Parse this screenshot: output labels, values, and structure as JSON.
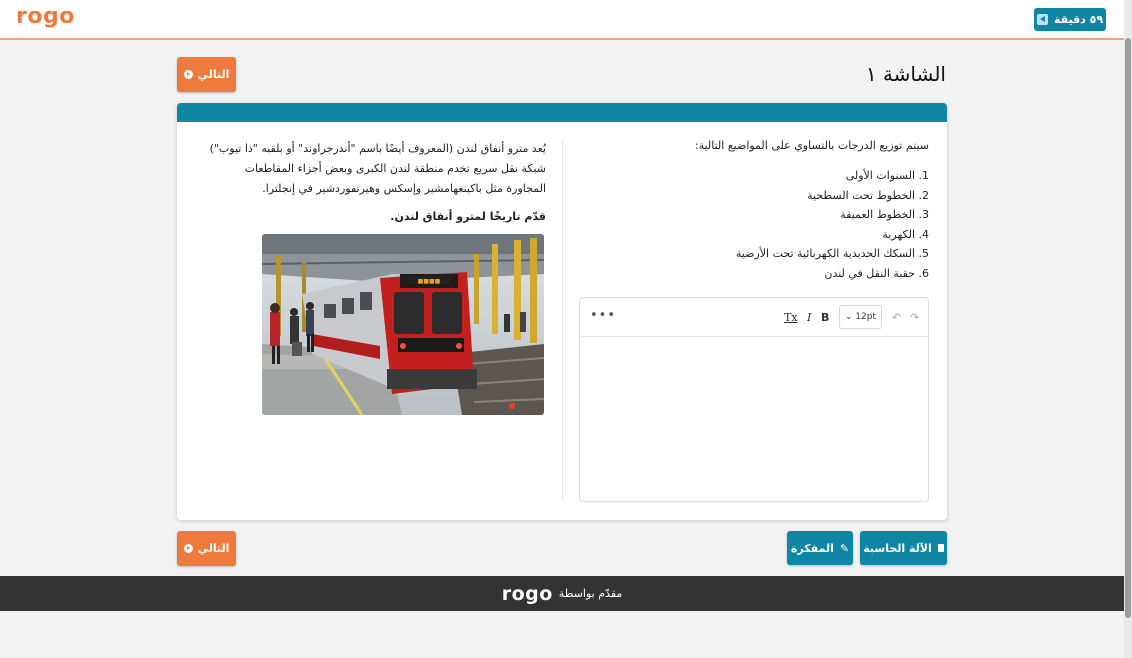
{
  "header": {
    "logo": "rogo",
    "timer_label": "٥٩ دقيقة"
  },
  "page": {
    "title": "الشاشة ١",
    "next_label": "التالي"
  },
  "question": {
    "intro": "سيتم توزيع الدرجات بالتساوي على المواضيع التالية:",
    "topics": [
      "1. السنوات الأولى",
      "2. الخطوط تحت السطحية",
      "3. الخطوط العميقة",
      "4. الكهربة",
      "5. السكك الحديدية الكهربائية تحت الأرضية",
      "6. حقبة النقل في لندن"
    ]
  },
  "editor": {
    "more_label": "•••",
    "clear_format_label": "Tx",
    "italic_label": "I",
    "bold_label": "B",
    "font_size": "12pt",
    "undo_label": "↶",
    "redo_label": "↷"
  },
  "stimulus": {
    "passage": "يُعد مترو أنفاق لندن (المعروف أيضًا باسم \"أندرجراوند\" أو بلقبه \"ذا تيوب\") شبكة نقل سريع تخدم منطقة لندن الكبرى وبعض أجزاء المقاطعات المجاورة مثل باكينغهامشير وإسكس وهيرتفوردشير في إنجلترا.",
    "prompt": "قدّم تاريخًا لمترو أنفاق لندن."
  },
  "tools": {
    "calculator_label": "الآلة الحاسبة",
    "notepad_label": "المفكرة"
  },
  "footer": {
    "powered_by": "مقدّم بواسطة",
    "logo": "rogo"
  },
  "colors": {
    "brand_orange": "#ee7b3d",
    "brand_blue": "#0f86a4",
    "footer_bg": "#333333"
  }
}
